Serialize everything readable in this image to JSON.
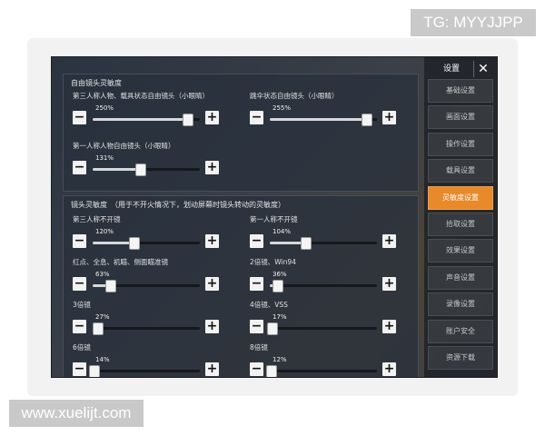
{
  "watermarks": {
    "top": "TG: MYYJJPP",
    "bottom": "www.xuelijt.com"
  },
  "panel": {
    "title": "设置",
    "close_symbol": "✕"
  },
  "menu": {
    "items": [
      {
        "label": "基础设置",
        "active": false
      },
      {
        "label": "画面设置",
        "active": false
      },
      {
        "label": "操作设置",
        "active": false
      },
      {
        "label": "载具设置",
        "active": false
      },
      {
        "label": "灵敏度设置",
        "active": true
      },
      {
        "label": "拾取设置",
        "active": false
      },
      {
        "label": "效果设置",
        "active": false
      },
      {
        "label": "声音设置",
        "active": false
      },
      {
        "label": "录像设置",
        "active": false
      },
      {
        "label": "账户安全",
        "active": false
      },
      {
        "label": "资源下载",
        "active": false
      }
    ]
  },
  "free_camera": {
    "title": "自由镜头灵敏度",
    "settings": [
      {
        "label": "第三人称人物、载具状态自由镜头（小眼睛）",
        "value": "250%",
        "level": 0.88
      },
      {
        "label": "跳伞状态自由镜头（小眼睛）",
        "value": "255%",
        "level": 0.9
      },
      {
        "label": "第一人称人物自由镜头（小眼睛）",
        "value": "131%",
        "level": 0.44
      }
    ]
  },
  "scope_camera": {
    "title": "镜头灵敏度　（用于不开火情况下，划动屏幕时镜头转动的灵敏度）",
    "settings": [
      {
        "label": "第三人称不开镜",
        "value": "120%",
        "level": 0.38
      },
      {
        "label": "第一人称不开镜",
        "value": "104%",
        "level": 0.33
      },
      {
        "label": "红点、全息、机瞄、侧面瞄准镜",
        "value": "63%",
        "level": 0.16
      },
      {
        "label": "2倍镜、Win94",
        "value": "36%",
        "level": 0.07
      },
      {
        "label": "3倍镜",
        "value": "27%",
        "level": 0.04
      },
      {
        "label": "4倍镜、VSS",
        "value": "17%",
        "level": 0.02
      },
      {
        "label": "6倍镜",
        "value": "14%",
        "level": 0.01
      },
      {
        "label": "8倍镜",
        "value": "12%",
        "level": 0.01
      }
    ]
  },
  "colors": {
    "accent": "#e8892a",
    "panel_bg": "#2f3742",
    "button_bg": "#f2f2f2"
  }
}
